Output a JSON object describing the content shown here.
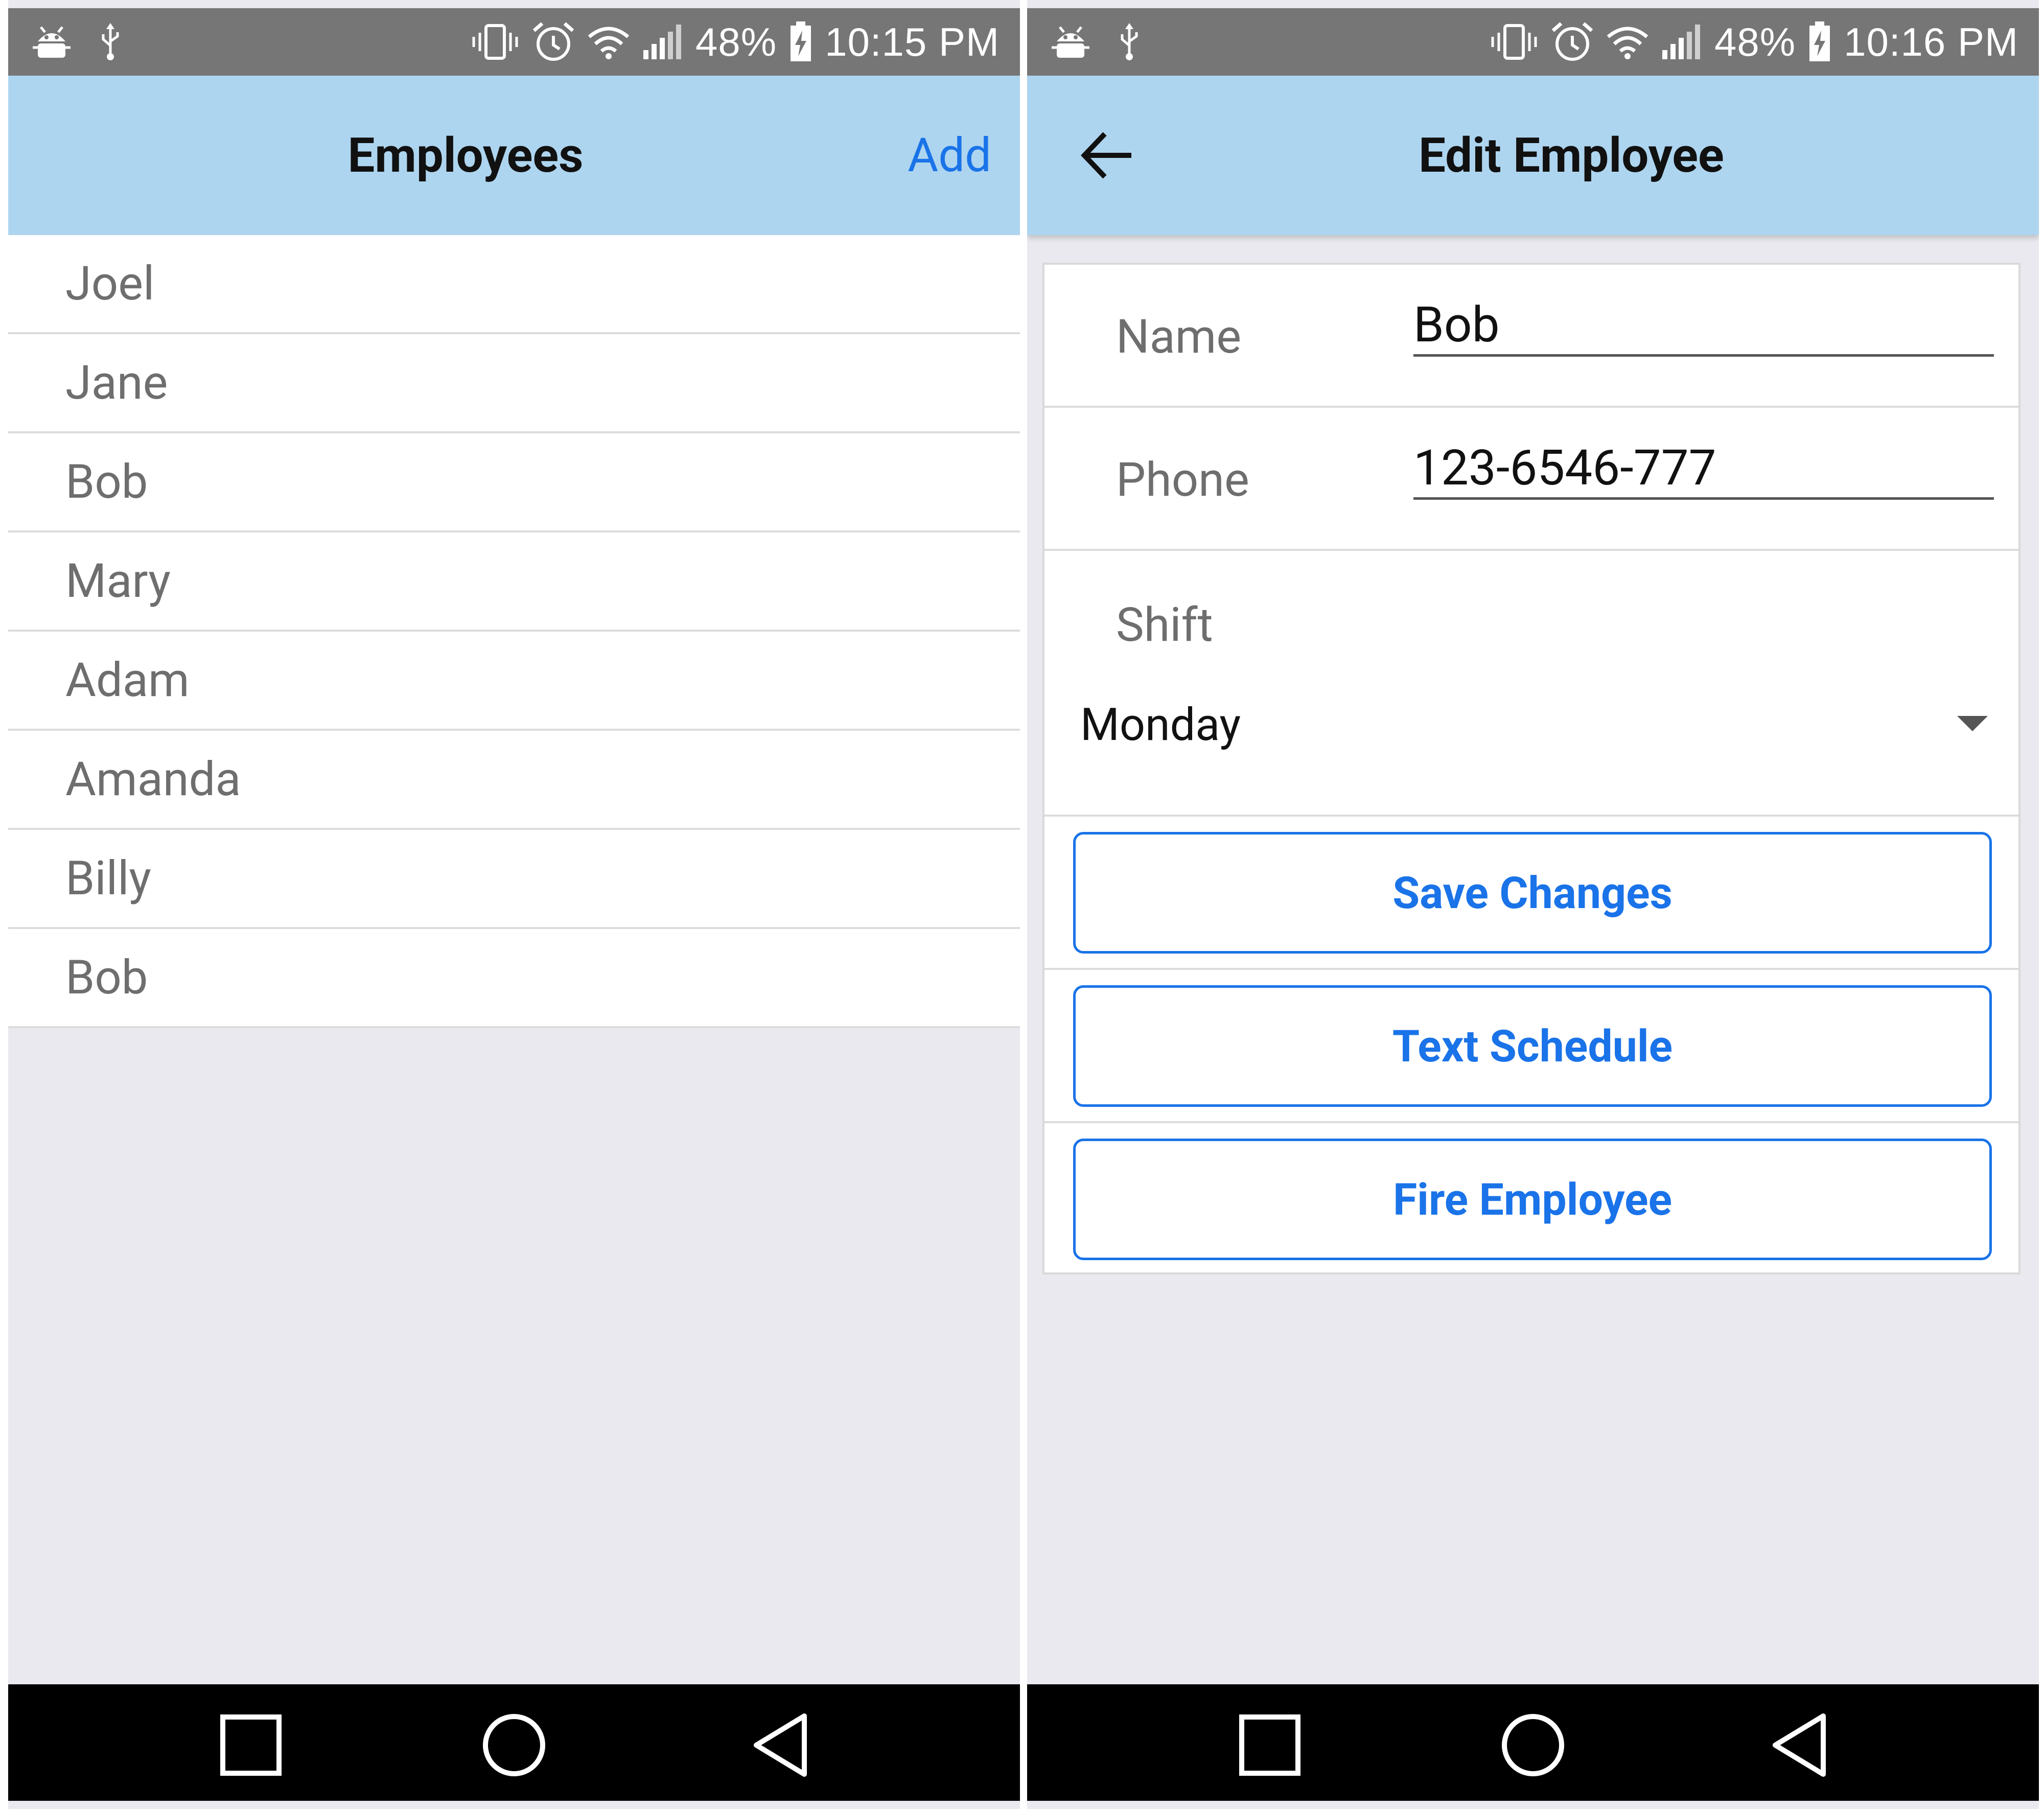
{
  "status_left": {
    "time": "10:15 PM",
    "battery": "48%"
  },
  "status_right": {
    "time": "10:16 PM",
    "battery": "48%"
  },
  "employees_screen": {
    "title": "Employees",
    "add_label": "Add",
    "items": [
      "Joel",
      "Jane",
      "Bob",
      "Mary",
      "Adam",
      "Amanda",
      "Billy",
      "Bob"
    ]
  },
  "edit_screen": {
    "title": "Edit Employee",
    "name_label": "Name",
    "name_value": "Bob",
    "phone_label": "Phone",
    "phone_value": "123-6546-777",
    "shift_label": "Shift",
    "shift_value": "Monday",
    "save_label": "Save Changes",
    "text_label": "Text Schedule",
    "fire_label": "Fire Employee"
  },
  "colors": {
    "nav_bar": "#aed5ef",
    "status_bar": "#767676",
    "accent": "#1a73e8",
    "page_bg": "#e9e9ef"
  },
  "icons": [
    "android-debug-icon",
    "usb-icon",
    "vibrate-icon",
    "alarm-icon",
    "wifi-icon",
    "signal-icon",
    "battery-charging-icon",
    "back-arrow-icon",
    "dropdown-arrow-icon",
    "recents-icon",
    "home-icon",
    "back-icon"
  ]
}
